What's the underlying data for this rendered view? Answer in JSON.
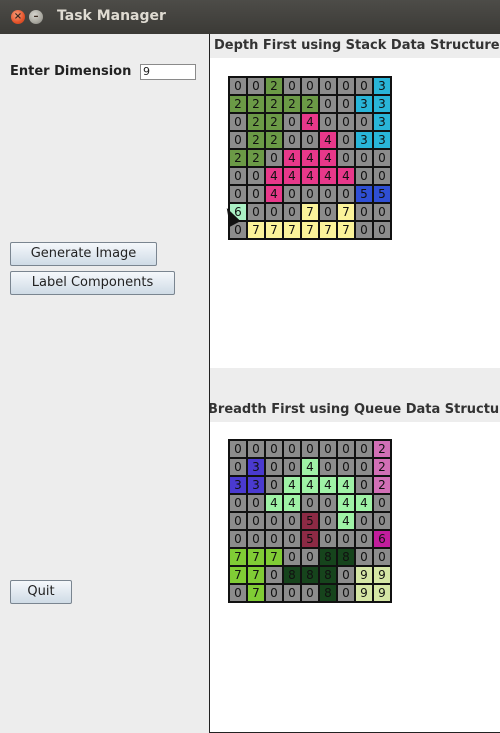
{
  "window": {
    "title": "Task Manager"
  },
  "form": {
    "dimension_label": "Enter Dimension",
    "dimension_value": "9"
  },
  "buttons": {
    "generate": "Generate Image",
    "label": "Label Components",
    "quit": "Quit"
  },
  "panels": {
    "dfs_title": "Depth First using Stack Data Structures",
    "bfs_title": "Breadth First using Queue Data Structures"
  },
  "colors": {
    "0": "#8c8c8c",
    "1": "#ffffff",
    "2": "#6b9a46",
    "3": "#29b5d8",
    "4": "#e8388a",
    "5": "#2f4fd4",
    "6": "#aaf0c4",
    "7": "#fbf39a",
    "b2": "#d26fb6",
    "b3": "#4a3ad0",
    "b4": "#9ff2a6",
    "b5": "#8c2a45",
    "b6": "#c21d9d",
    "b7": "#80cc35",
    "b8": "#16441c",
    "b9": "#d5e6a5"
  },
  "dfs_grid": [
    [
      "0",
      "0",
      "2",
      "0",
      "0",
      "0",
      "0",
      "0",
      "3"
    ],
    [
      "2",
      "2",
      "2",
      "2",
      "2",
      "0",
      "0",
      "3",
      "3"
    ],
    [
      "0",
      "2",
      "2",
      "0",
      "4",
      "0",
      "0",
      "0",
      "3"
    ],
    [
      "0",
      "2",
      "2",
      "0",
      "0",
      "4",
      "0",
      "3",
      "3"
    ],
    [
      "2",
      "2",
      "0",
      "4",
      "4",
      "4",
      "0",
      "0",
      "0"
    ],
    [
      "0",
      "0",
      "4",
      "4",
      "4",
      "4",
      "4",
      "0",
      "0"
    ],
    [
      "0",
      "0",
      "4",
      "0",
      "0",
      "0",
      "0",
      "5",
      "5"
    ],
    [
      "6",
      "0",
      "0",
      "0",
      "7",
      "0",
      "7",
      "0",
      "0"
    ],
    [
      "0",
      "7",
      "7",
      "7",
      "7",
      "7",
      "7",
      "0",
      "0"
    ]
  ],
  "bfs_grid": [
    [
      "0",
      "0",
      "0",
      "0",
      "0",
      "0",
      "0",
      "0",
      "2"
    ],
    [
      "0",
      "3",
      "0",
      "0",
      "4",
      "0",
      "0",
      "0",
      "2"
    ],
    [
      "3",
      "3",
      "0",
      "4",
      "4",
      "4",
      "4",
      "0",
      "2"
    ],
    [
      "0",
      "0",
      "4",
      "4",
      "0",
      "0",
      "4",
      "4",
      "0"
    ],
    [
      "0",
      "0",
      "0",
      "0",
      "5",
      "0",
      "4",
      "0",
      "0"
    ],
    [
      "0",
      "0",
      "0",
      "0",
      "5",
      "0",
      "0",
      "0",
      "6"
    ],
    [
      "7",
      "7",
      "7",
      "0",
      "0",
      "8",
      "8",
      "0",
      "0"
    ],
    [
      "7",
      "7",
      "0",
      "8",
      "8",
      "8",
      "0",
      "9",
      "9"
    ],
    [
      "0",
      "7",
      "0",
      "0",
      "0",
      "8",
      "0",
      "9",
      "9"
    ]
  ]
}
